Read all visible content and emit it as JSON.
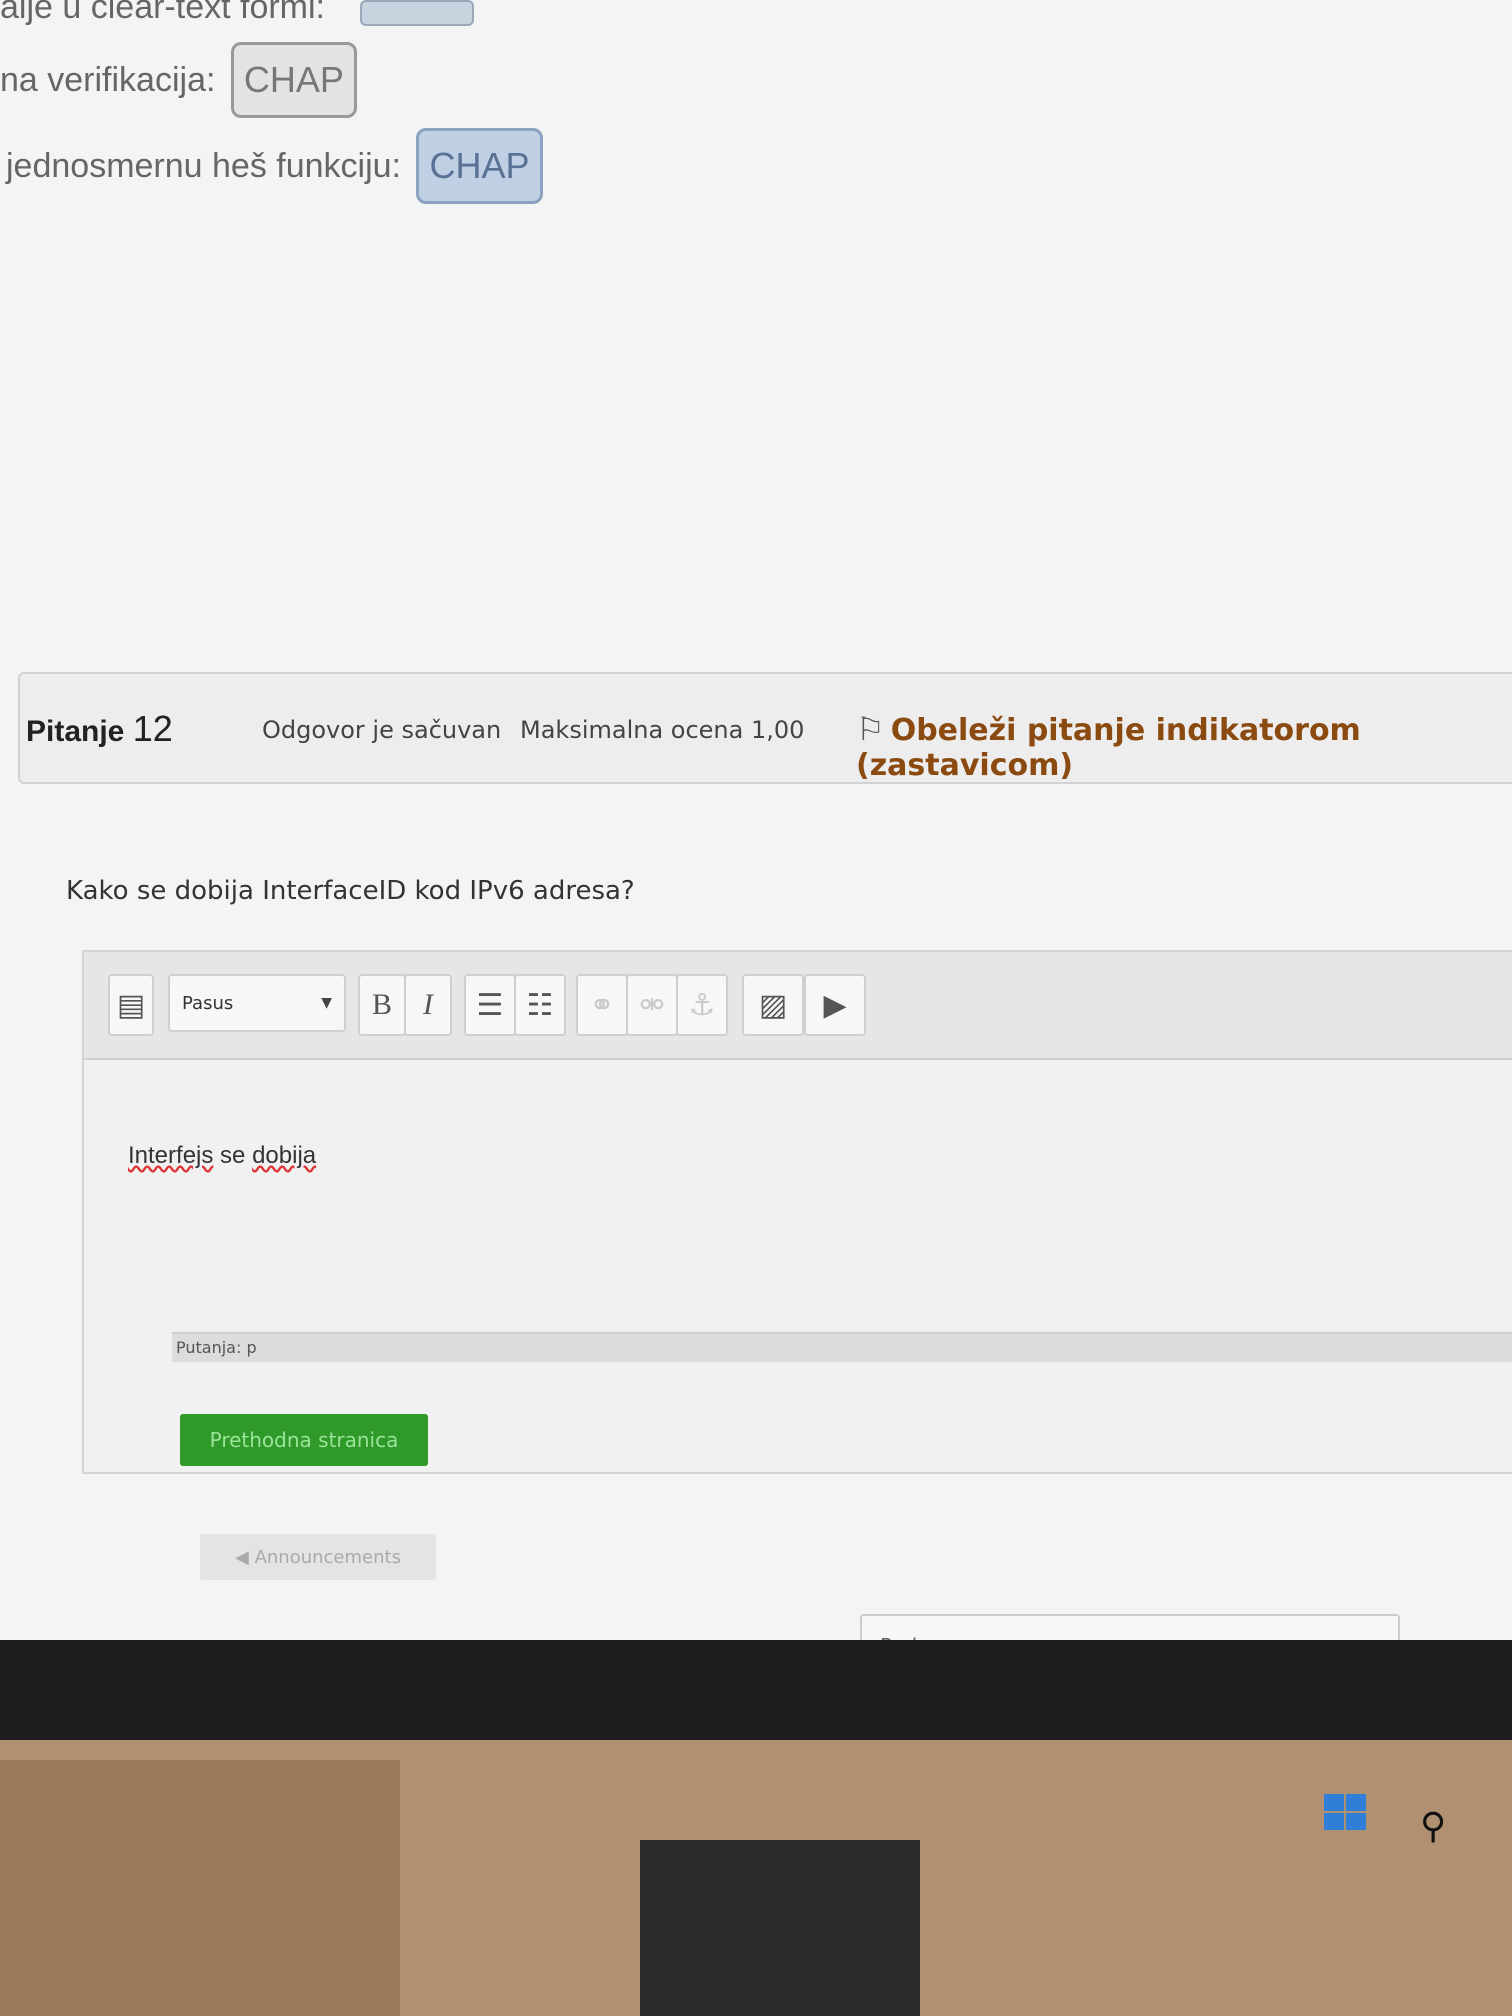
{
  "previous_question": {
    "row1_label": "alje u clear-text formi:",
    "row2_label": "na verifikacija:",
    "row2_value": "CHAP",
    "row3_label": "jednosmernu heš funkciju:",
    "row3_value": "CHAP"
  },
  "question": {
    "label": "Pitanje",
    "number": "12",
    "state": "Odgovor je sačuvan",
    "grade": "Maksimalna ocena 1,00",
    "flag_label": "Obeleži pitanje indikatorom (zastavicom)",
    "text": "Kako se dobija InterfaceID kod IPv6 adresa?"
  },
  "editor": {
    "paragraph_format": "Pasus",
    "bold_label": "B",
    "italic_label": "I",
    "body_word1": "Interfejs",
    "body_word2": "se",
    "body_word3": "dobija",
    "status_path": "Putanja: p"
  },
  "navigation": {
    "previous_page": "Prethodna stranica",
    "announcements_link": "◀ Announcements",
    "jump_to_placeholder": "Prelaz na..."
  },
  "colors": {
    "flag_text": "#8a4a10",
    "prev_button": "#2f9a2a",
    "selected_select": "#bfd0e4"
  }
}
